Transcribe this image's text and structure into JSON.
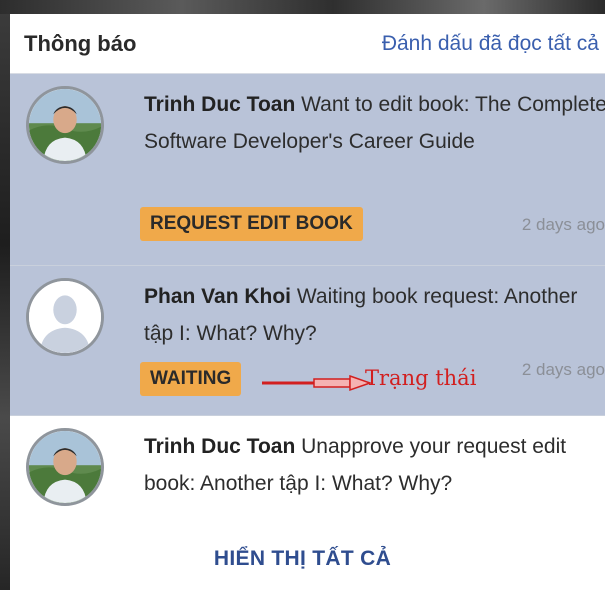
{
  "header": {
    "title": "Thông báo",
    "mark_all_read": "Đánh dấu đã đọc tất cả"
  },
  "notifications": [
    {
      "avatar": "user-photo-avatar",
      "user": "Trinh Duc Toan",
      "message": " Want to edit book: The Complete Software Developer's Career Guide",
      "badge": "REQUEST EDIT BOOK",
      "time": "2 days ago",
      "state": "unread"
    },
    {
      "avatar": "default-silhouette-avatar",
      "user": "Phan Van Khoi",
      "message": " Waiting book request: Another tập I: What? Why?",
      "badge": "WAITING",
      "time": "2 days ago",
      "state": "unread"
    },
    {
      "avatar": "user-photo-avatar",
      "user": "Trinh Duc Toan",
      "message": " Unapprove your request edit book: Another tập I: What? Why?",
      "state": "read"
    }
  ],
  "annotation": {
    "label": "Trạng thái",
    "color": "#d21f1f"
  },
  "footer": {
    "show_all": "HIỂN THỊ TẤT CẢ"
  },
  "colors": {
    "unread_bg": "#b9c3d8",
    "badge": "#f0a94a",
    "link": "#3a5fae"
  }
}
